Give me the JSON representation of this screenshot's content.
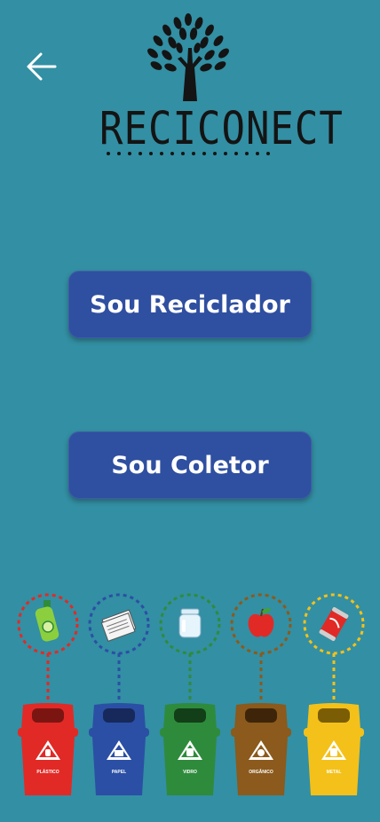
{
  "header": {
    "back_icon": "arrow-left-icon",
    "logo_text": "RECICONECT"
  },
  "actions": {
    "reciclador_label": "Sou Reciclador",
    "coletor_label": "Sou Coletor"
  },
  "bins": [
    {
      "label": "PLÁSTICO",
      "color": "#e12a26",
      "icon": "bottle-icon"
    },
    {
      "label": "PAPEL",
      "color": "#2b4fa5",
      "icon": "paper-icon"
    },
    {
      "label": "VIDRO",
      "color": "#2e8b3c",
      "icon": "jar-icon"
    },
    {
      "label": "ORGÂNICO",
      "color": "#8b5a1c",
      "icon": "apple-icon"
    },
    {
      "label": "METAL",
      "color": "#f3c11a",
      "icon": "can-icon"
    }
  ]
}
